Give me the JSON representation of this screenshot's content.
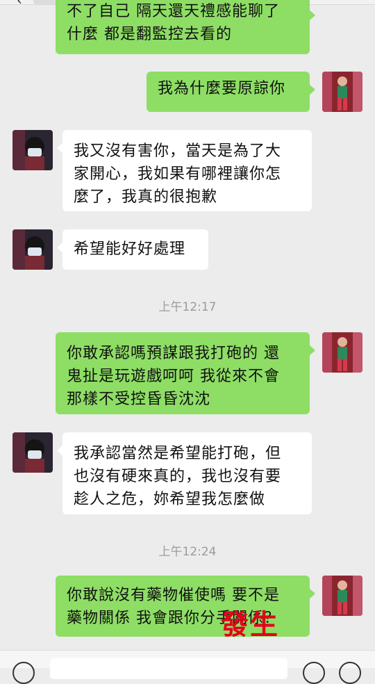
{
  "messages": [
    {
      "side": "me",
      "lines": [
        "不了自己 隔天還天禮感能聊了",
        "什麼 都是翻監控去看的"
      ]
    },
    {
      "side": "me",
      "lines": [
        "我為什麼要原諒你"
      ]
    },
    {
      "side": "other",
      "lines": [
        "我又沒有害你，當天是為了大",
        "家開心，我如果有哪裡讓你怎",
        "麼了，我真的很抱歉"
      ]
    },
    {
      "side": "other",
      "lines": [
        "希望能好好處理"
      ]
    },
    {
      "side": "me",
      "lines": [
        "你敢承認嗎預謀跟我打砲的 還",
        "鬼扯是玩遊戲呵呵 我從來不會",
        "那樣不受控昏昏沈沈"
      ]
    },
    {
      "side": "other",
      "lines": [
        "我承認當然是希望能打砲，但",
        "也沒有硬來真的，我也沒有要",
        "趁人之危，妳希望我怎麼做"
      ]
    },
    {
      "side": "me",
      "lines": [
        "你敢說沒有藥物催使嗎 要不是",
        "藥物關係 我會跟你分手關係？"
      ]
    }
  ],
  "timestamps": [
    "上午12:17",
    "上午12:24"
  ],
  "overlay": "發生",
  "colors": {
    "me_bubble": "#8ede65",
    "other_bubble": "#ffffff",
    "background": "#ececec",
    "overlay": "#e4001a"
  }
}
